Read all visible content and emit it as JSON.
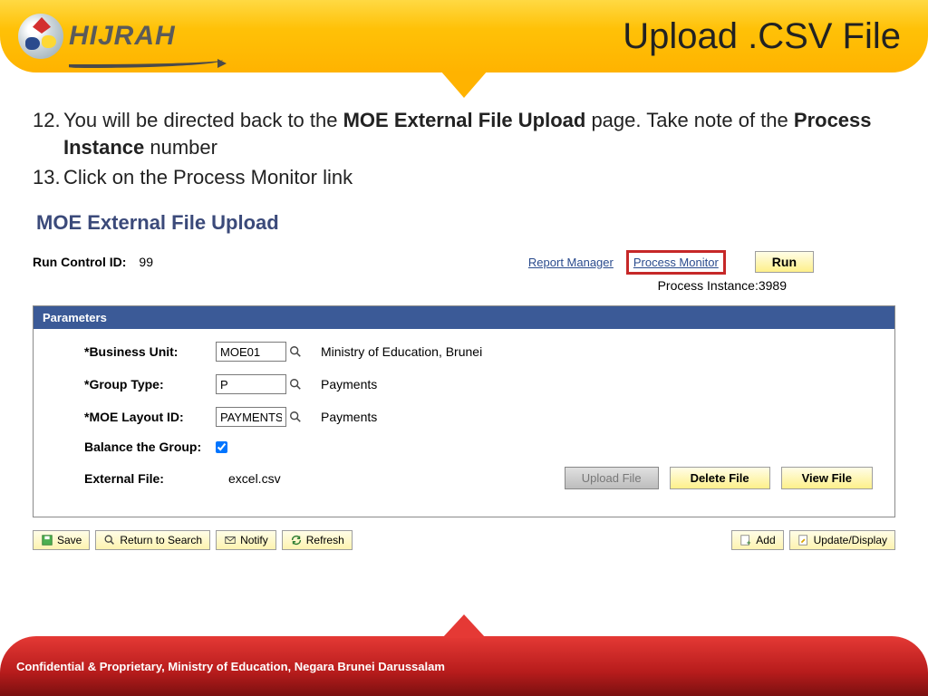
{
  "header": {
    "logo_text": "HIJRAH",
    "title": "Upload .CSV File"
  },
  "instructions": {
    "items": [
      {
        "num": "12.",
        "prefix": "You will be directed back to the ",
        "bold1": "MOE External File Upload",
        "mid": " page. Take note of the ",
        "bold2": "Process Instance",
        "suffix": " number"
      },
      {
        "num": "13.",
        "text": "Click on the Process Monitor link"
      }
    ]
  },
  "screenshot": {
    "page_heading": "MOE External File Upload",
    "run_control_label": "Run Control ID:",
    "run_control_value": "99",
    "links": {
      "report_manager": "Report Manager",
      "process_monitor": "Process Monitor"
    },
    "run_button": "Run",
    "process_instance_label": "Process Instance:",
    "process_instance_value": "3989",
    "parameters": {
      "header": "Parameters",
      "fields": {
        "business_unit": {
          "label": "*Business Unit:",
          "value": "MOE01",
          "desc": "Ministry of Education, Brunei"
        },
        "group_type": {
          "label": "*Group Type:",
          "value": "P",
          "desc": "Payments"
        },
        "moe_layout": {
          "label": "*MOE Layout ID:",
          "value": "PAYMENTS",
          "desc": "Payments"
        },
        "balance": {
          "label": "Balance the Group:",
          "checked": true
        },
        "external_file": {
          "label": "External File:",
          "filename": "excel.csv"
        }
      },
      "buttons": {
        "upload": "Upload File",
        "delete": "Delete File",
        "view": "View File"
      }
    },
    "toolbar": {
      "save": "Save",
      "return": "Return to Search",
      "notify": "Notify",
      "refresh": "Refresh",
      "add": "Add",
      "update": "Update/Display"
    }
  },
  "footer": {
    "text": "Confidential & Proprietary, Ministry of Education, Negara Brunei Darussalam"
  }
}
